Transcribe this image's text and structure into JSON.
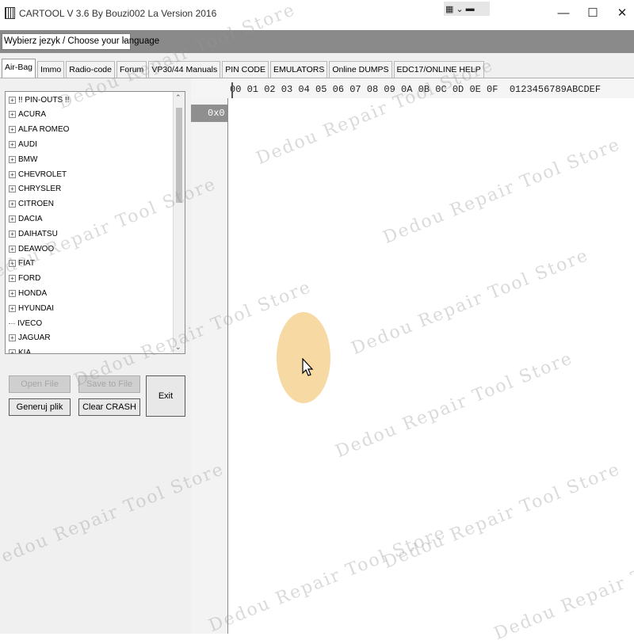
{
  "window": {
    "title": "CARTOOL V 3.6 By Bouzi002 La Version 2016",
    "toolbar_icons": [
      "grid-icon",
      "chevron-down-icon",
      "minus-icon"
    ],
    "controls": {
      "minimize": "—",
      "maximize": "☐",
      "close": "✕"
    }
  },
  "language": {
    "selected": "Wybierz jezyk / Choose your language"
  },
  "tabs": [
    {
      "label": "Air-Bag",
      "active": true
    },
    {
      "label": "Immo"
    },
    {
      "label": "Radio-code"
    },
    {
      "label": "Forum"
    },
    {
      "label": "VP30/44 Manuals"
    },
    {
      "label": "PIN CODE"
    },
    {
      "label": "EMULATORS"
    },
    {
      "label": "Online DUMPS"
    },
    {
      "label": "EDC17/ONLINE HELP"
    }
  ],
  "tree": {
    "items": [
      {
        "label": "!! PIN-OUTS !!",
        "expandable": true
      },
      {
        "label": "ACURA",
        "expandable": true
      },
      {
        "label": "ALFA ROMEO",
        "expandable": true
      },
      {
        "label": "AUDI",
        "expandable": true
      },
      {
        "label": "BMW",
        "expandable": true
      },
      {
        "label": "CHEVROLET",
        "expandable": true
      },
      {
        "label": "CHRYSLER",
        "expandable": true
      },
      {
        "label": "CITROEN",
        "expandable": true
      },
      {
        "label": "DACIA",
        "expandable": true
      },
      {
        "label": "DAIHATSU",
        "expandable": true
      },
      {
        "label": "DEAWOO",
        "expandable": true
      },
      {
        "label": "FIAT",
        "expandable": true
      },
      {
        "label": "FORD",
        "expandable": true
      },
      {
        "label": "HONDA",
        "expandable": true
      },
      {
        "label": "HYUNDAI",
        "expandable": true
      },
      {
        "label": "IVECO",
        "expandable": false
      },
      {
        "label": "JAGUAR",
        "expandable": true
      },
      {
        "label": "KIA",
        "expandable": true
      }
    ]
  },
  "buttons": {
    "open_file": "Open File",
    "save_to_file": "Save to File",
    "generuj_plik": "Generuj plik",
    "clear_crash": "Clear CRASH",
    "exit": "Exit"
  },
  "hex": {
    "header": "00 01 02 03 04 05 06 07 08 09 0A 0B 0C 0D 0E 0F  0123456789ABCDEF",
    "address": "0x0"
  },
  "watermark": [
    "Dedou Repair Tool Store"
  ],
  "colors": {
    "click_highlight": "#f5d79e",
    "language_bar": "#8a8a8a",
    "address_bg": "#8f8f8f"
  }
}
